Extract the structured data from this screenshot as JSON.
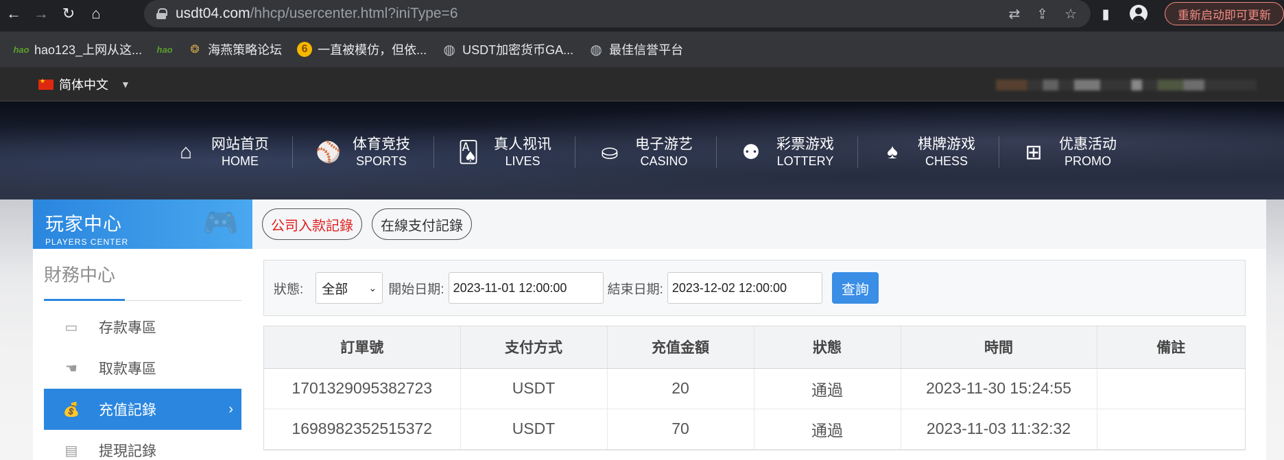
{
  "browser": {
    "url_host": "usdt04.com",
    "url_path": "/hhcp/usercenter.html?iniType=6",
    "update_label": "重新启动即可更新"
  },
  "bookmarks": [
    {
      "label": "hao123_上网从这...",
      "icon": "hao123-icon"
    },
    {
      "label": "",
      "icon": "hao-icon"
    },
    {
      "label": "海燕策略论坛",
      "icon": "site-logo-icon"
    },
    {
      "label": "一直被模仿，但依...",
      "icon": "coin-icon"
    },
    {
      "label": "USDT加密货币GA...",
      "icon": "globe-icon"
    },
    {
      "label": "最佳信誉平台",
      "icon": "globe-icon"
    }
  ],
  "site": {
    "language": "简体中文",
    "nav": [
      {
        "zh": "网站首页",
        "en": "HOME",
        "icon": "home-icon"
      },
      {
        "zh": "体育竞技",
        "en": "SPORTS",
        "icon": "ball-icon"
      },
      {
        "zh": "真人视讯",
        "en": "LIVES",
        "icon": "cards-icon"
      },
      {
        "zh": "电子游艺",
        "en": "CASINO",
        "icon": "roulette-icon"
      },
      {
        "zh": "彩票游戏",
        "en": "LOTTERY",
        "icon": "lottery-balls-icon"
      },
      {
        "zh": "棋牌游戏",
        "en": "CHESS",
        "icon": "spade-icon"
      },
      {
        "zh": "优惠活动",
        "en": "PROMO",
        "icon": "gift-icon"
      }
    ]
  },
  "sidebar": {
    "header_zh": "玩家中心",
    "header_en": "PLAYERS CENTER",
    "section_title": "財務中心",
    "items": [
      {
        "label": "存款專區",
        "icon": "card-icon",
        "active": false
      },
      {
        "label": "取款專區",
        "icon": "hand-money-icon",
        "active": false
      },
      {
        "label": "充值記錄",
        "icon": "money-bag-icon",
        "active": true
      },
      {
        "label": "提現記錄",
        "icon": "wallet-icon",
        "active": false
      }
    ]
  },
  "tabs": [
    {
      "label": "公司入款記錄",
      "active": true
    },
    {
      "label": "在線支付記錄",
      "active": false
    }
  ],
  "filter": {
    "status_label": "狀態:",
    "status_value": "全部",
    "start_label": "開始日期:",
    "start_value": "2023-11-01 12:00:00",
    "end_label": "結束日期:",
    "end_value": "2023-12-02 12:00:00",
    "query_label": "查詢"
  },
  "table": {
    "headers": [
      "訂單號",
      "支付方式",
      "充值金額",
      "狀態",
      "時間",
      "備註"
    ],
    "rows": [
      [
        "1701329095382723",
        "USDT",
        "20",
        "通過",
        "2023-11-30 15:24:55",
        ""
      ],
      [
        "1698982352515372",
        "USDT",
        "70",
        "通過",
        "2023-11-03 11:32:32",
        ""
      ]
    ]
  },
  "colors": {
    "accent": "#2a86de",
    "query_button": "#3a8ee6",
    "active_tab_text": "#e02020"
  }
}
